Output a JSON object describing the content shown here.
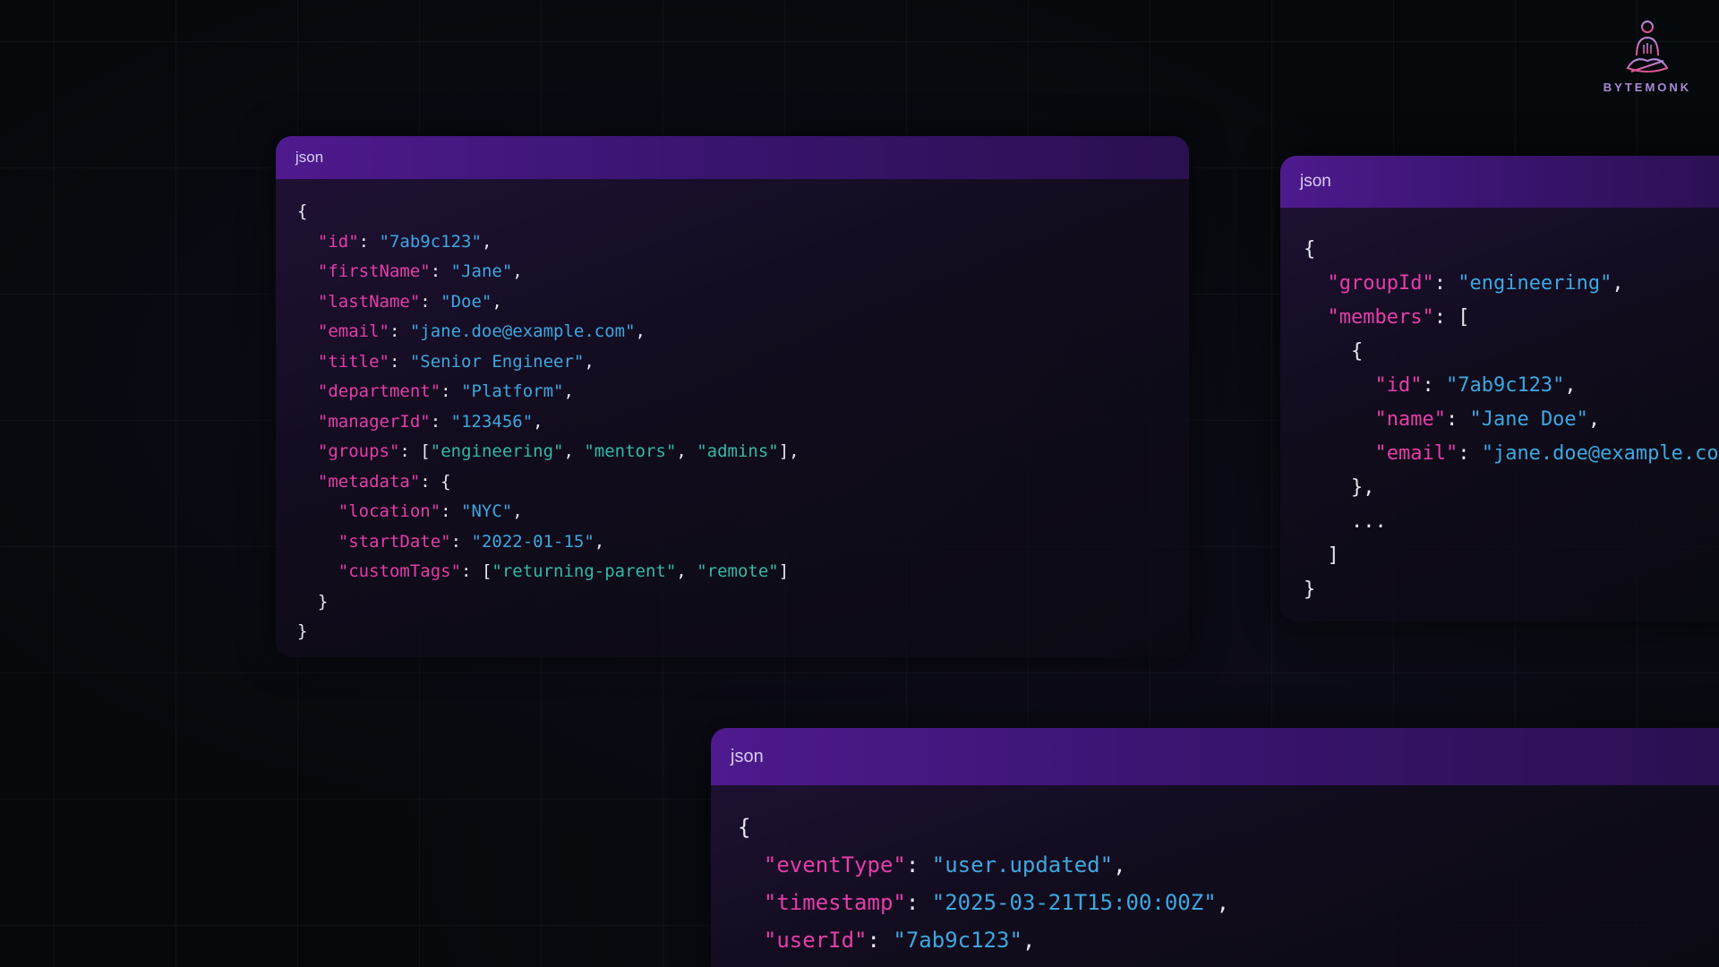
{
  "brand": {
    "name": "BYTEMONK",
    "logo_icon": "monk-meditating-icon",
    "accent_color": "#a98ad8"
  },
  "colors": {
    "background": "#06090c",
    "panel_header": "#4e1a8e",
    "json_key": "#e33ea8",
    "json_string": "#3fa7e0",
    "json_string_alt": "#35b8a8",
    "punctuation": "#e8e8ee"
  },
  "panels": {
    "user": {
      "label": "json",
      "lines": [
        {
          "indent": 0,
          "text": "{"
        },
        {
          "indent": 1,
          "key": "\"id\"",
          "value": "\"7ab9c123\"",
          "tail": ","
        },
        {
          "indent": 1,
          "key": "\"firstName\"",
          "value": "\"Jane\"",
          "tail": ","
        },
        {
          "indent": 1,
          "key": "\"lastName\"",
          "value": "\"Doe\"",
          "tail": ","
        },
        {
          "indent": 1,
          "key": "\"email\"",
          "value": "\"jane.doe@example.com\"",
          "tail": ","
        },
        {
          "indent": 1,
          "key": "\"title\"",
          "value": "\"Senior Engineer\"",
          "tail": ","
        },
        {
          "indent": 1,
          "key": "\"department\"",
          "value": "\"Platform\"",
          "tail": ","
        },
        {
          "indent": 1,
          "key": "\"managerId\"",
          "value": "\"123456\"",
          "tail": ","
        },
        {
          "indent": 1,
          "key": "\"groups\"",
          "array": [
            "\"engineering\"",
            "\"mentors\"",
            "\"admins\""
          ],
          "tail": ","
        },
        {
          "indent": 1,
          "key": "\"metadata\"",
          "open": "{"
        },
        {
          "indent": 2,
          "key": "\"location\"",
          "value": "\"NYC\"",
          "tail": ","
        },
        {
          "indent": 2,
          "key": "\"startDate\"",
          "value": "\"2022-01-15\"",
          "tail": ","
        },
        {
          "indent": 2,
          "key": "\"customTags\"",
          "array": [
            "\"returning-parent\"",
            "\"remote\""
          ],
          "tail": ""
        },
        {
          "indent": 1,
          "text": "}"
        },
        {
          "indent": 0,
          "text": "}"
        }
      ]
    },
    "group": {
      "label": "json",
      "lines": [
        {
          "indent": 0,
          "text": "{"
        },
        {
          "indent": 1,
          "key": "\"groupId\"",
          "value": "\"engineering\"",
          "tail": ","
        },
        {
          "indent": 1,
          "key": "\"members\"",
          "open": "["
        },
        {
          "indent": 2,
          "text": "{"
        },
        {
          "indent": 3,
          "key": "\"id\"",
          "value": "\"7ab9c123\"",
          "tail": ","
        },
        {
          "indent": 3,
          "key": "\"name\"",
          "value": "\"Jane Doe\"",
          "tail": ","
        },
        {
          "indent": 3,
          "key": "\"email\"",
          "value": "\"jane.doe@example.com\"",
          "tail": ""
        },
        {
          "indent": 2,
          "text": "},"
        },
        {
          "indent": 2,
          "text": "..."
        },
        {
          "indent": 1,
          "text": "]"
        },
        {
          "indent": 0,
          "text": "}"
        }
      ]
    },
    "event": {
      "label": "json",
      "lines": [
        {
          "indent": 0,
          "text": "{"
        },
        {
          "indent": 1,
          "key": "\"eventType\"",
          "value": "\"user.updated\"",
          "tail": ","
        },
        {
          "indent": 1,
          "key": "\"timestamp\"",
          "value": "\"2025-03-21T15:00:00Z\"",
          "tail": ","
        },
        {
          "indent": 1,
          "key": "\"userId\"",
          "value": "\"7ab9c123\"",
          "tail": ","
        }
      ]
    }
  }
}
